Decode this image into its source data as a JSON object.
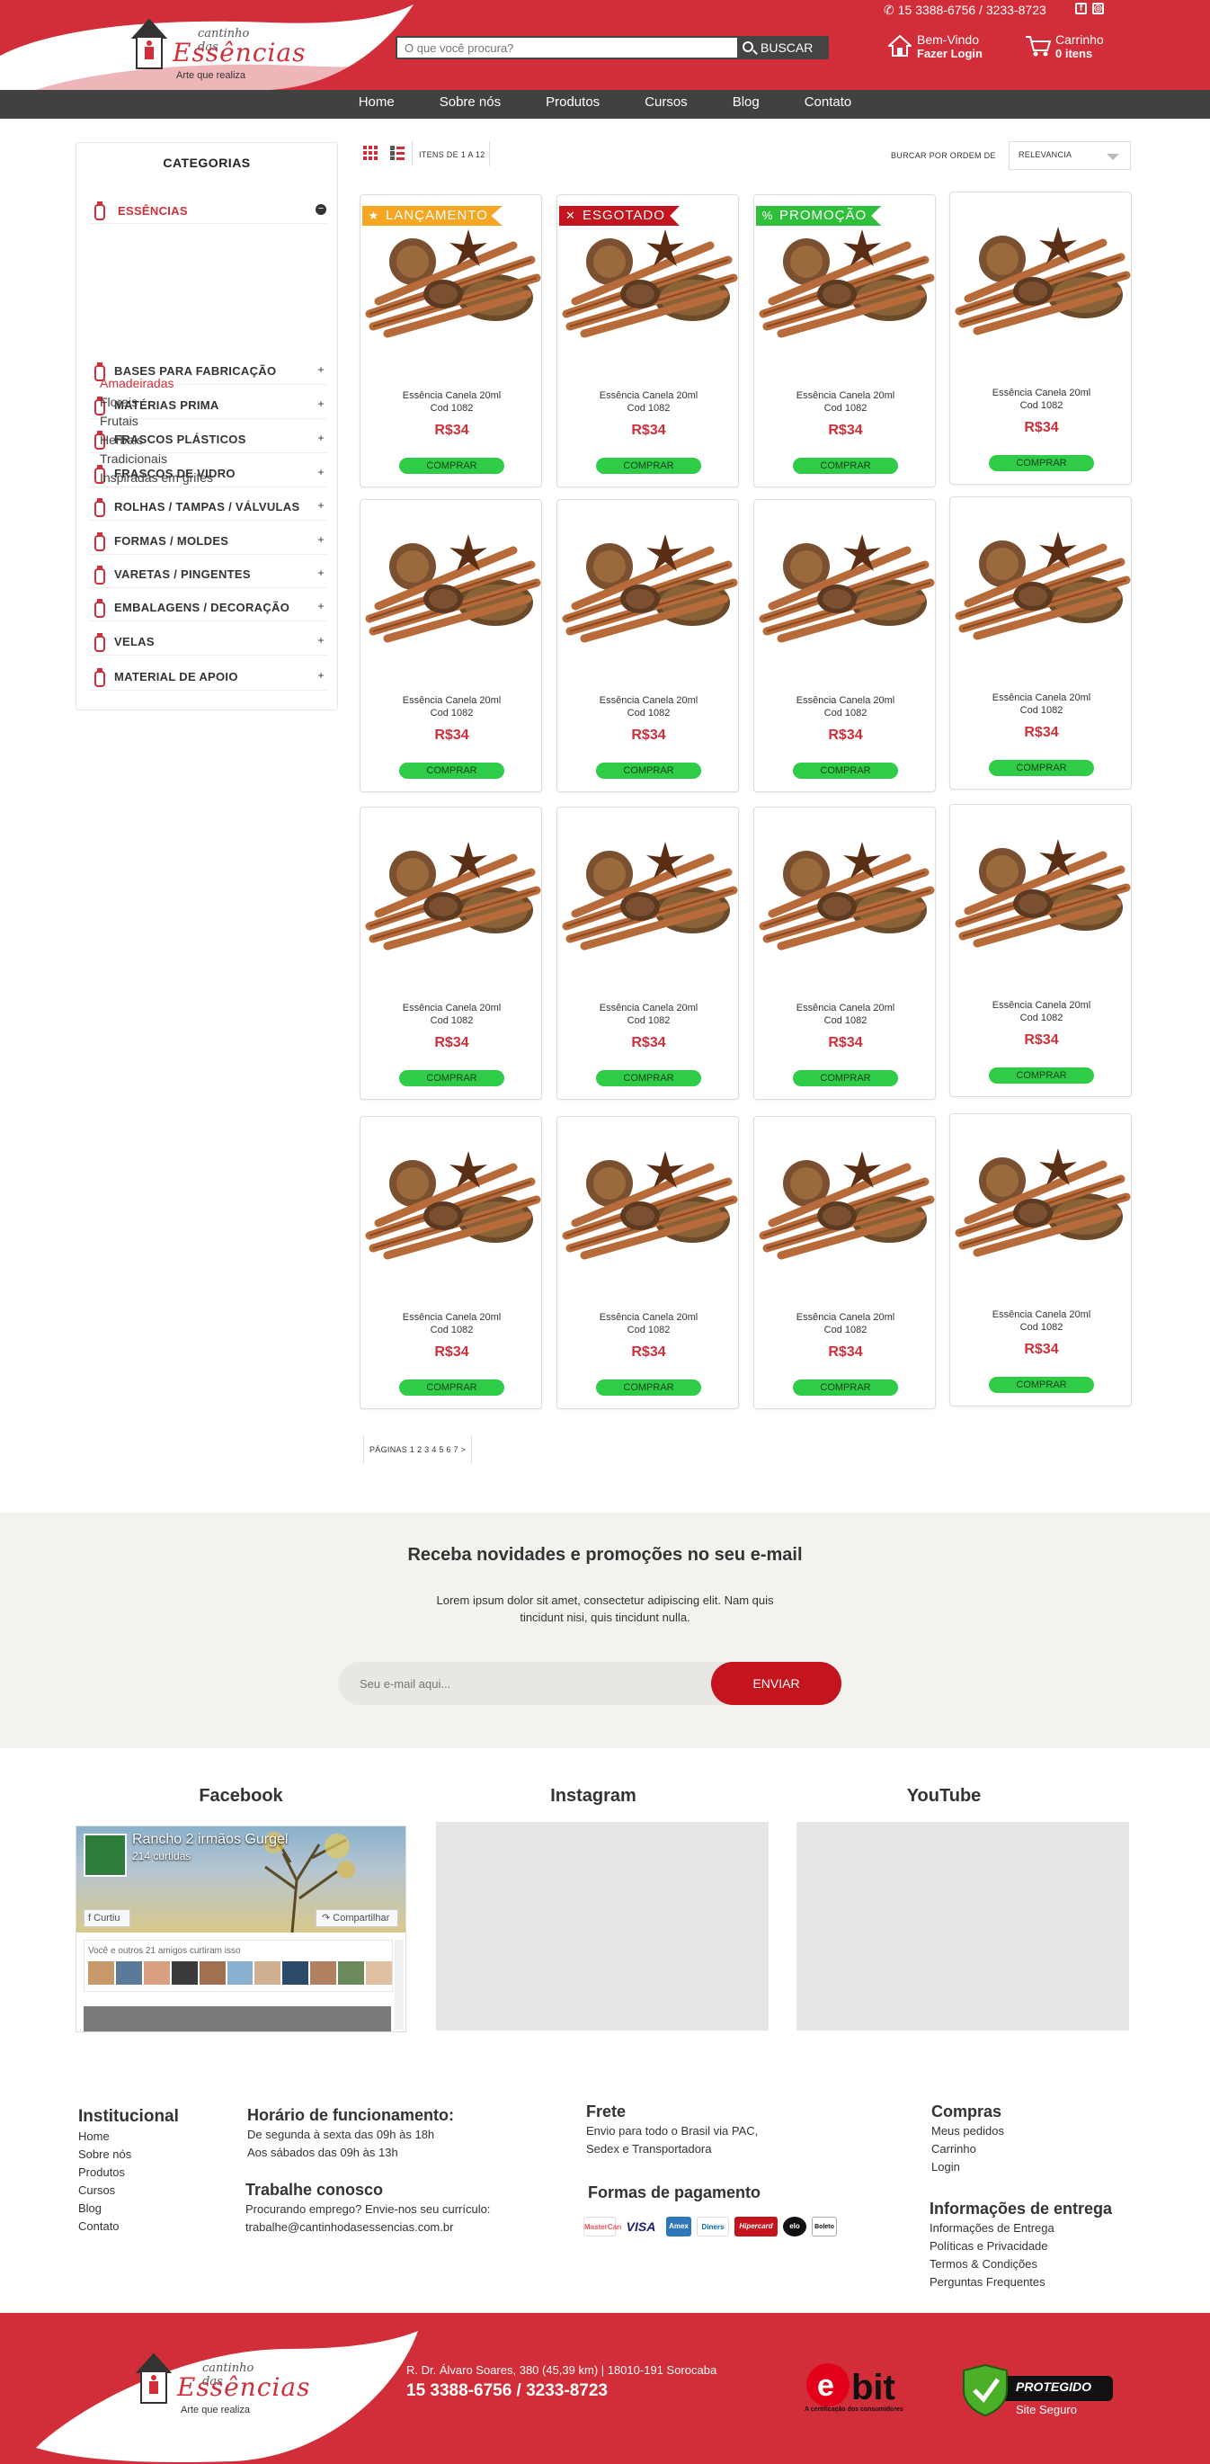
{
  "header": {
    "logo_small": "cantinho das",
    "logo_big": "Essências",
    "logo_tagline": "Arte que realiza",
    "phone": "15 3388-6756 / 3233-8723",
    "search_placeholder": "O que você procura?",
    "search_button": "BUSCAR",
    "welcome": "Bem-Vindo",
    "login": "Fazer Login",
    "cart_label": "Carrinho",
    "cart_count": "0 itens"
  },
  "nav": [
    "Home",
    "Sobre nós",
    "Produtos",
    "Cursos",
    "Blog",
    "Contato"
  ],
  "sidebar": {
    "title": "CATEGORIAS",
    "categories": [
      {
        "label": "ESSÊNCIAS",
        "icon": "essence-icon",
        "active": true
      },
      {
        "label": "BASES PARA FABRICAÇÃO",
        "icon": "bottle-icon"
      },
      {
        "label": "MATÉRIAS PRIMA",
        "icon": "bowl-icon"
      },
      {
        "label": "FRASCOS PLÁSTICOS",
        "icon": "plastic-bottle-icon"
      },
      {
        "label": "FRASCOS DE VIDRO",
        "icon": "glass-bottle-icon"
      },
      {
        "label": "ROLHAS / TAMPAS / VÁLVULAS",
        "icon": "valve-icon"
      },
      {
        "label": "FORMAS / MOLDES",
        "icon": "mold-icon"
      },
      {
        "label": "VARETAS / PINGENTES",
        "icon": "pendant-icon"
      },
      {
        "label": "EMBALAGENS / DECORAÇÃO",
        "icon": "package-icon"
      },
      {
        "label": "VELAS",
        "icon": "candle-icon"
      },
      {
        "label": "MATERIAL DE APOIO",
        "icon": "flask-icon"
      }
    ],
    "subcategories": [
      "Amadeiradas",
      "Florais",
      "Frutais",
      "Herbais",
      "Tradicionais",
      "Inspiradas em grifes"
    ],
    "expand_symbol": "+",
    "collapse_symbol": "−"
  },
  "toolbar": {
    "items_text": "ITENS DE 1 A 12",
    "sort_label": "BURCAR POR ORDEM DE",
    "sort_value": "RELEVANCIA"
  },
  "product": {
    "name": "Essência Canela 20ml",
    "code": "Cod 1082",
    "price": "R$34",
    "buy": "COMPRAR"
  },
  "badges": [
    {
      "label": "LANÇAMENTO",
      "color": "#f5a623",
      "icon": "star-icon"
    },
    {
      "label": "ESGOTADO",
      "color": "#c4141e",
      "icon": "x-icon"
    },
    {
      "label": "PROMOÇÃO",
      "color": "#2fbf3a",
      "icon": "percent-icon"
    }
  ],
  "pagination": "PÁGINAS 1  2  3  4   5  6  7  >",
  "newsletter": {
    "title": "Receba novidades e promoções no seu e-mail",
    "text": "Lorem ipsum dolor sit amet, consectetur adipiscing elit. Nam quis tincidunt nisi, quis tincidunt nulla.",
    "placeholder": "Seu e-mail aqui...",
    "button": "ENVIAR"
  },
  "social": {
    "facebook": "Facebook",
    "instagram": "Instagram",
    "youtube": "YouTube",
    "fb_page": "Rancho 2 irmãos Gurgel",
    "fb_likes": "214 curtidas",
    "fb_like_btn": "Curtiu",
    "fb_share_btn": "Compartilhar",
    "fb_friends": "Você e outros 21 amigos curtiram isso"
  },
  "footer": {
    "institucional_title": "Institucional",
    "institucional_links": [
      "Home",
      "Sobre nós",
      "Produtos",
      "Cursos",
      "Blog",
      "Contato"
    ],
    "horario_title": "Horário de funcionamento:",
    "horario_lines": [
      "De segunda à sexta das 09h às 18h",
      "Aos sábados das 09h às 13h"
    ],
    "trabalhe_title": "Trabalhe conosco",
    "trabalhe_lines": [
      "Procurando emprego? Envie-nos seu currículo:",
      "trabalhe@cantinhodasessencias.com.br"
    ],
    "frete_title": "Frete",
    "frete_lines": [
      "Envio para todo o Brasil via PAC,",
      "Sedex e Transportadora"
    ],
    "pagamento_title": "Formas de pagamento",
    "compras_title": "Compras",
    "compras_links": [
      "Meus pedidos",
      "Carrinho",
      "Login"
    ],
    "entrega_title": "Informações de entrega",
    "entrega_links": [
      "Informações de Entrega",
      "Políticas e Privacidade",
      "Termos & Condições",
      "Perguntas Frequentes"
    ],
    "address": "R. Dr. Álvaro Soares, 380 (45,39 km) | 18010-191 Sorocaba",
    "phone": "15 3388-6756 / 3233-8723",
    "ebit_caption": "A certificação dos consumidores",
    "protegido": "PROTEGIDO",
    "site_seguro": "Site Seguro",
    "payment_cards": [
      "MasterCard",
      "VISA",
      "Amex",
      "Diners",
      "Hipercard",
      "elo",
      "Boleto"
    ]
  },
  "colors": {
    "brand_red": "#d12e39",
    "nav_dark": "#414141",
    "buy_green": "#2fcc47"
  }
}
